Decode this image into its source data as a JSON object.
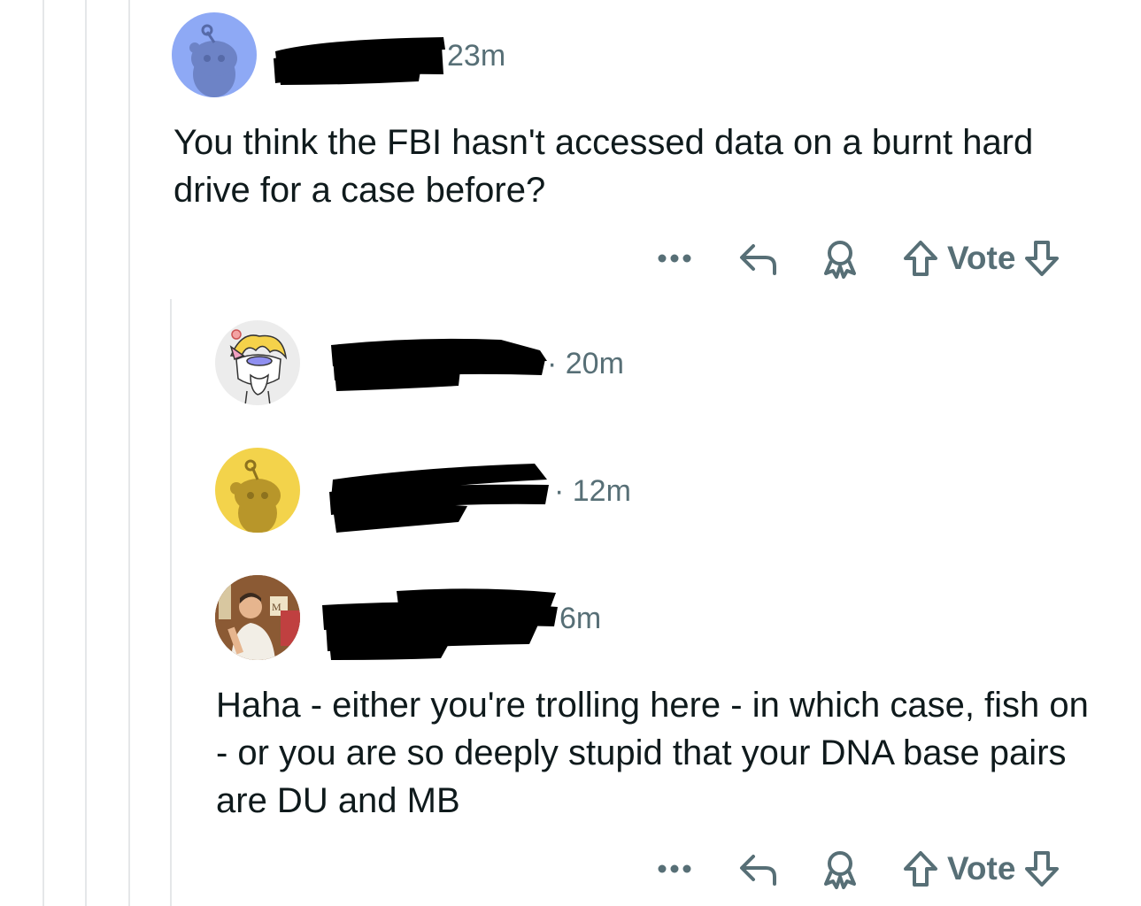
{
  "colors": {
    "thread_line": "#e5e7e9",
    "meta_text": "#576f76",
    "body_text": "#0f1a1c",
    "redaction": "#000000",
    "avatar_blue": "#8ea9f5",
    "avatar_yellow": "#f3d34b"
  },
  "comments": [
    {
      "avatar": "snoo-avatar-blue",
      "username_redacted": true,
      "time": "23m",
      "body": "You think the FBI hasn't accessed data on a burnt hard drive for a case before?",
      "actions": {
        "more_icon": "ellipsis-icon",
        "reply_icon": "reply-icon",
        "award_icon": "award-icon",
        "vote_label": "Vote"
      }
    },
    {
      "avatar": "cartoon-cat-avatar",
      "username_redacted": true,
      "time": "· 20m",
      "body": ""
    },
    {
      "avatar": "snoo-avatar-yellow",
      "username_redacted": true,
      "time": "· 12m",
      "body": ""
    },
    {
      "avatar": "photo-avatar",
      "username_redacted": true,
      "time": "6m",
      "body": "Haha - either you're trolling here - in which case, fish on - or you are so deeply stupid that your DNA base pairs are DU and MB",
      "actions": {
        "more_icon": "ellipsis-icon",
        "reply_icon": "reply-icon",
        "award_icon": "award-icon",
        "vote_label": "Vote"
      }
    }
  ]
}
